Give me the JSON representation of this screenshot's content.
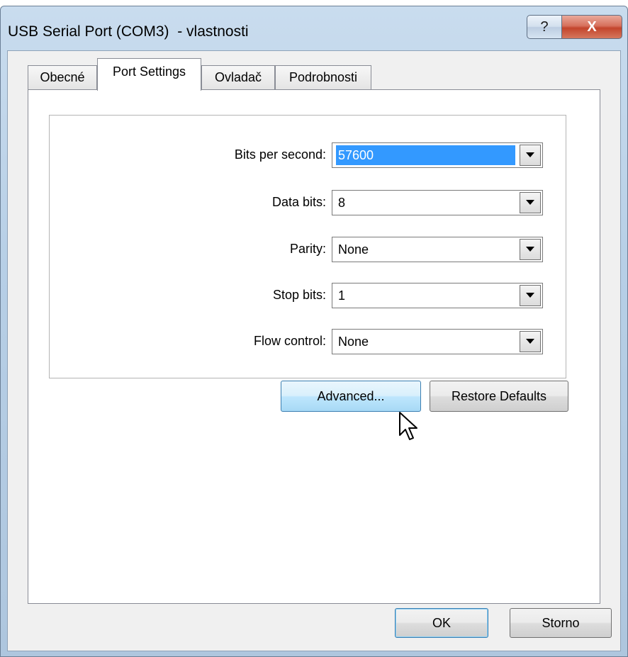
{
  "window": {
    "title": "USB Serial Port (COM3)  - vlastnosti",
    "help_glyph": "?",
    "close_glyph": "X"
  },
  "tabs": [
    {
      "label": "Obecné",
      "active": false
    },
    {
      "label": "Port Settings",
      "active": true
    },
    {
      "label": "Ovladač",
      "active": false
    },
    {
      "label": "Podrobnosti",
      "active": false
    }
  ],
  "settings": {
    "bits_per_second": {
      "label": "Bits per second:",
      "value": "57600"
    },
    "data_bits": {
      "label": "Data bits:",
      "value": "8"
    },
    "parity": {
      "label": "Parity:",
      "value": "None"
    },
    "stop_bits": {
      "label": "Stop bits:",
      "value": "1"
    },
    "flow_control": {
      "label": "Flow control:",
      "value": "None"
    }
  },
  "buttons": {
    "advanced": "Advanced...",
    "restore_defaults": "Restore Defaults",
    "ok": "OK",
    "cancel": "Storno"
  },
  "colors": {
    "selection": "#3399ff",
    "close_button": "#c3452c",
    "hover_border": "#3c7fb1"
  }
}
